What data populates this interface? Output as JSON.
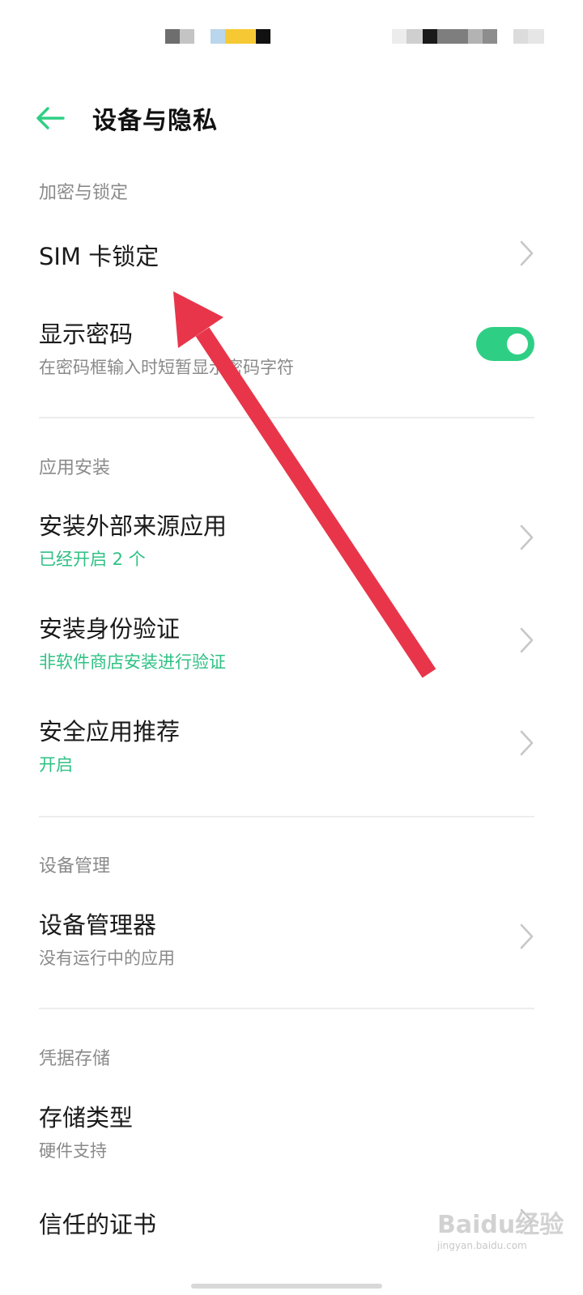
{
  "header": {
    "title": "设备与隐私"
  },
  "sections": {
    "encryption": {
      "title": "加密与锁定",
      "sim_lock": {
        "title": "SIM 卡锁定"
      },
      "show_password": {
        "title": "显示密码",
        "subtitle": "在密码框输入时短暂显示密码字符",
        "toggle_on": true
      }
    },
    "app_install": {
      "title": "应用安装",
      "external_sources": {
        "title": "安装外部来源应用",
        "subtitle": "已经开启 2 个"
      },
      "install_verification": {
        "title": "安装身份验证",
        "subtitle": "非软件商店安装进行验证"
      },
      "security_recommend": {
        "title": "安全应用推荐",
        "subtitle": "开启"
      }
    },
    "device_management": {
      "title": "设备管理",
      "device_admin": {
        "title": "设备管理器",
        "subtitle": "没有运行中的应用"
      }
    },
    "credential_storage": {
      "title": "凭据存储",
      "storage_type": {
        "title": "存储类型",
        "subtitle": "硬件支持"
      },
      "trusted_certs": {
        "title": "信任的证书"
      }
    }
  },
  "watermark": {
    "main": "Baidu经验",
    "sub": "jingyan.baidu.com"
  },
  "colors": {
    "accent": "#2ecf84",
    "accent_text": "#2fc184",
    "annotation_arrow": "#e8354a"
  }
}
